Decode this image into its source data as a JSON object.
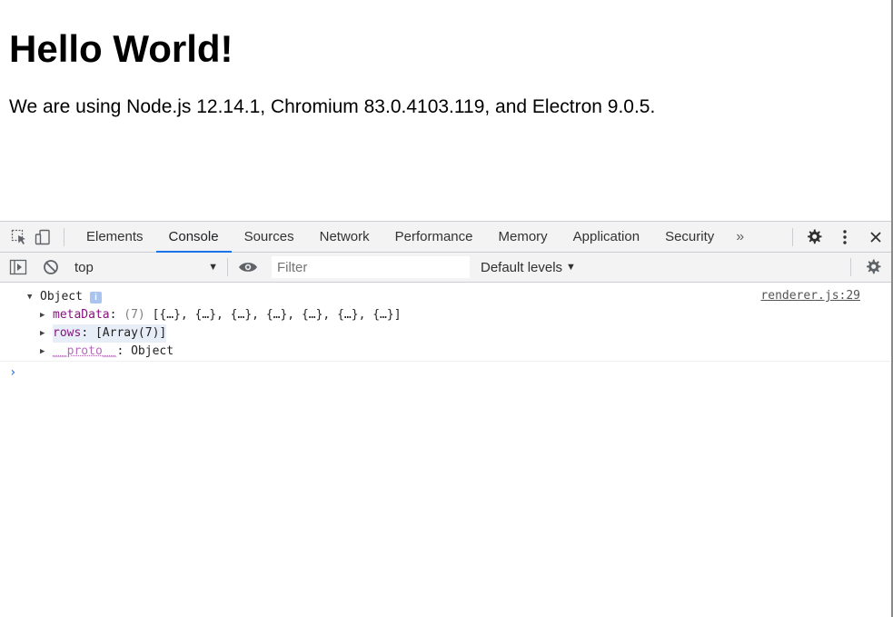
{
  "page": {
    "heading": "Hello World!",
    "text": "We are using Node.js 12.14.1, Chromium 83.0.4103.119, and Electron 9.0.5."
  },
  "devtools": {
    "tabs": [
      "Elements",
      "Console",
      "Sources",
      "Network",
      "Performance",
      "Memory",
      "Application",
      "Security"
    ],
    "active_tab": "Console",
    "more_tabs": "»",
    "toolbar": {
      "context": "top",
      "filter_placeholder": "Filter",
      "levels": "Default levels"
    },
    "console": {
      "source": "renderer.js:29",
      "object_label": "Object",
      "info_badge": "i",
      "props": [
        {
          "key": "metaData",
          "sep": ": ",
          "count": "(7) ",
          "value": "[{…}, {…}, {…}, {…}, {…}, {…}, {…}]"
        },
        {
          "key": "rows",
          "sep": ": ",
          "value": "[Array(7)]"
        },
        {
          "key": "__proto__",
          "sep": ": ",
          "value": "Object"
        }
      ],
      "prompt": "›"
    },
    "colors": {
      "accent": "#1a73e8",
      "property_key": "#881280",
      "toolbar_bg": "#f3f3f3"
    },
    "icons": [
      "inspect-element-icon",
      "device-toolbar-icon",
      "settings-gear-icon",
      "kebab-menu-icon",
      "close-icon",
      "show-sidebar-icon",
      "clear-console-icon",
      "eye-icon",
      "console-settings-icon"
    ]
  }
}
